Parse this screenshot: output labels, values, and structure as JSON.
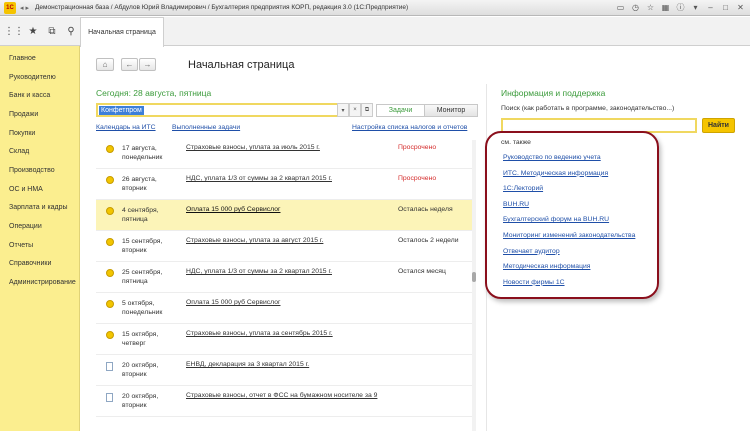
{
  "window": {
    "title": "Демонстрационная база / Абдулов Юрий Владимирович / Бухгалтерия предприятия КОРП, редакция 3.0 (1С:Предприятие)",
    "logo": "1С"
  },
  "toolbar": {
    "tab_label": "Начальная страница"
  },
  "sidebar": {
    "items": [
      {
        "label": "Главное"
      },
      {
        "label": "Руководителю"
      },
      {
        "label": "Банк и касса"
      },
      {
        "label": "Продажи"
      },
      {
        "label": "Покупки"
      },
      {
        "label": "Склад"
      },
      {
        "label": "Производство"
      },
      {
        "label": "ОС и НМА"
      },
      {
        "label": "Зарплата и кадры"
      },
      {
        "label": "Операции"
      },
      {
        "label": "Отчеты"
      },
      {
        "label": "Справочники"
      },
      {
        "label": "Администрирование"
      }
    ]
  },
  "main": {
    "page_title": "Начальная страница",
    "today": "Сегодня: 28 августа, пятница",
    "filter_value": "Конфетпром",
    "toggle_tasks": "Задачи",
    "toggle_monitor": "Монитор",
    "link_calendar": "Календарь на ИТС",
    "link_done": "Выполненные задачи",
    "link_settings": "Настройка списка налогов и отчетов",
    "tasks": [
      {
        "date": "17 августа,\nпонедельник",
        "title": "Страховые взносы, уплата за июль 2015 г.",
        "status": "Просрочено",
        "icon": "coin"
      },
      {
        "date": "26 августа,\nвторник",
        "title": "НДС, уплата 1/3 от суммы за 2 квартал 2015 г.",
        "status": "Просрочено",
        "icon": "coin"
      },
      {
        "date": "4 сентября,\nпятница",
        "title": "Оплата 15 000 руб Сервислог",
        "status": "Осталась неделя",
        "icon": "coin"
      },
      {
        "date": "15 сентября,\nвторник",
        "title": "Страховые взносы, уплата за август 2015 г.",
        "status": "Осталось 2 недели",
        "icon": "coin"
      },
      {
        "date": "25 сентября,\nпятница",
        "title": "НДС, уплата 1/3 от суммы за 2 квартал 2015 г.",
        "status": "Остался месяц",
        "icon": "coin"
      },
      {
        "date": "5 октября,\nпонедельник",
        "title": "Оплата 15 000 руб Сервислог",
        "status": "",
        "icon": "coin"
      },
      {
        "date": "15 октября,\nчетверг",
        "title": "Страховые взносы, уплата за сентябрь 2015 г.",
        "status": "",
        "icon": "coin"
      },
      {
        "date": "20 октября,\nвторник",
        "title": "ЕНВД, декларация за 3 квартал 2015 г.",
        "status": "",
        "icon": "doc"
      },
      {
        "date": "20 октября,\nвторник",
        "title": "Страховые взносы, отчет в ФСС на бумажном носителе за 9",
        "status": "",
        "icon": "doc"
      }
    ]
  },
  "info": {
    "title": "Информация и поддержка",
    "search_label": "Поиск (как работать в программе, законодательство...)",
    "search_value": "",
    "search_button": "Найти",
    "see_also": "см. также",
    "links": [
      "Руководство по ведению учета",
      "ИТС. Методическая информация",
      "1С:Лекторий",
      "BUH.RU",
      "Бухгалтерский форум на BUH.RU",
      "Мониторинг изменений законодательства",
      "Отвечает аудитор",
      "Методическая информация",
      "Новости фирмы 1С"
    ]
  },
  "colors": {
    "sidebar_bg": "#fbee8f",
    "accent_green": "#3b9b3b",
    "overdue_red": "#d42a2a",
    "link_blue": "#1f4fa8",
    "highlight_ring": "#8a0f1c",
    "selected_row": "#fcf4b8"
  }
}
